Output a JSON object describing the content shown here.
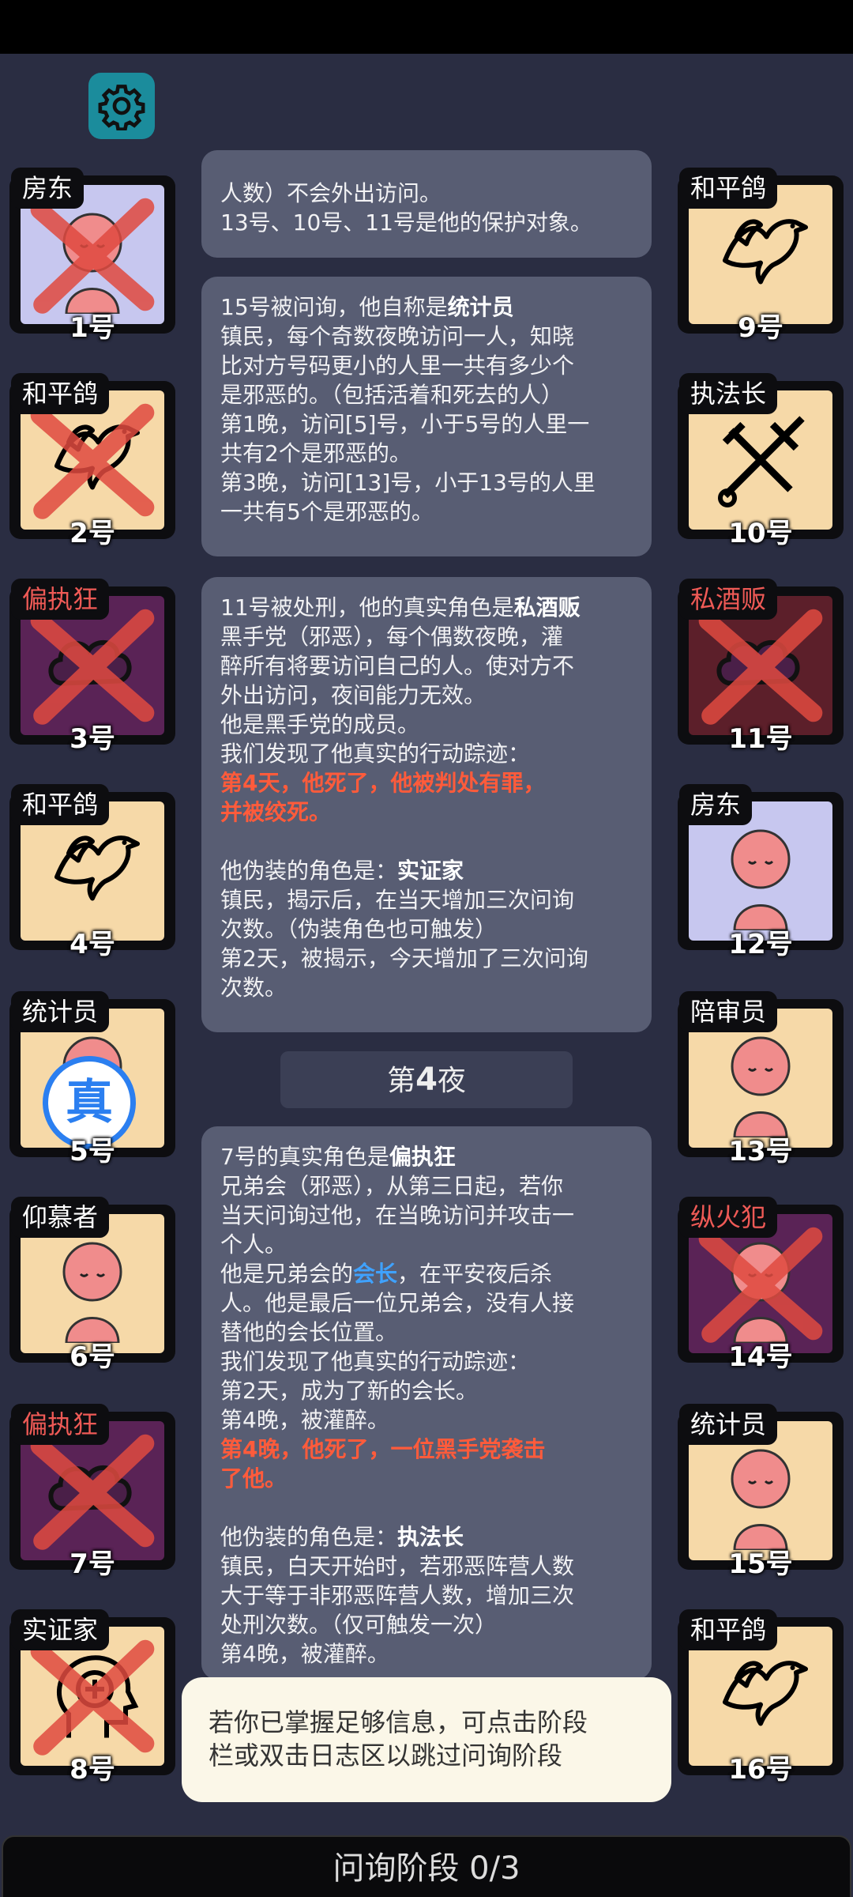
{
  "settings": {
    "icon": "gear-icon"
  },
  "left_cards": [
    {
      "role": "房东",
      "number": "1号",
      "bg": "#c7c7ef",
      "dead": true
    },
    {
      "role": "和平鸽",
      "number": "2号",
      "bg": "#f6d9a8",
      "dead": true
    },
    {
      "role": "偏执狂",
      "number": "3号",
      "bg": "#5a2356",
      "dead": true,
      "tag_color": "red"
    },
    {
      "role": "和平鸽",
      "number": "4号",
      "bg": "#f6d9a8",
      "dead": false
    },
    {
      "role": "统计员",
      "number": "5号",
      "bg": "#f6d9a8",
      "dead": false,
      "badge": "真"
    },
    {
      "role": "仰慕者",
      "number": "6号",
      "bg": "#f6d9a8",
      "dead": false
    },
    {
      "role": "偏执狂",
      "number": "7号",
      "bg": "#5a2356",
      "dead": true,
      "tag_color": "red"
    },
    {
      "role": "实证家",
      "number": "8号",
      "bg": "#f6d9a8",
      "dead": true
    }
  ],
  "right_cards": [
    {
      "role": "和平鸽",
      "number": "9号",
      "bg": "#f6d9a8",
      "dead": false
    },
    {
      "role": "执法长",
      "number": "10号",
      "bg": "#f6d9a8",
      "dead": false
    },
    {
      "role": "私酒贩",
      "number": "11号",
      "bg": "#5c1f2a",
      "dead": true,
      "tag_color": "red"
    },
    {
      "role": "房东",
      "number": "12号",
      "bg": "#c7c7ef",
      "dead": false
    },
    {
      "role": "陪审员",
      "number": "13号",
      "bg": "#f6d9a8",
      "dead": false
    },
    {
      "role": "纵火犯",
      "number": "14号",
      "bg": "#5a2356",
      "dead": true,
      "tag_color": "red"
    },
    {
      "role": "统计员",
      "number": "15号",
      "bg": "#f6d9a8",
      "dead": false
    },
    {
      "role": "和平鸽",
      "number": "16号",
      "bg": "#f6d9a8",
      "dead": false
    }
  ],
  "log": {
    "entry1": {
      "line1": "人数）不会外出访问。",
      "line2": "13号、10号、11号是他的保护对象。"
    },
    "entry2": {
      "intro": "15号被问询，他自称是",
      "role": "统计员",
      "lines": [
        "镇民，每个奇数夜晚访问一人，知晓",
        "比对方号码更小的人里一共有多少个",
        "是邪恶的。（包括活着和死去的人）",
        "第1晚，访问[5]号，小于5号的人里一",
        "共有2个是邪恶的。",
        "第3晚，访问[13]号，小于13号的人里",
        "一共有5个是邪恶的。"
      ]
    },
    "entry3": {
      "intro": "11号被处刑，他的真实角色是",
      "role": "私酒贩",
      "lines": [
        "黑手党（邪恶），每个偶数夜晚，灌",
        "醉所有将要访问自己的人。使对方不",
        "外出访问，夜间能力无效。",
        "他是黑手党的成员。",
        "我们发现了他真实的行动踪迹："
      ],
      "kill1": "第4天，他死了，他被判处有罪，",
      "kill2": "并被绞死。",
      "disguise_intro": "他伪装的角色是：",
      "disguise_role": "实证家",
      "lines2": [
        "镇民，揭示后，在当天增加三次问询",
        "次数。（伪装角色也可触发）",
        "第2天，被揭示，今天增加了三次问询",
        "次数。"
      ]
    },
    "night": {
      "prefix": "第",
      "num": "4",
      "suffix": "夜"
    },
    "entry4": {
      "intro": "7号的真实角色是",
      "role": "偏执狂",
      "lines": [
        "兄弟会（邪恶），从第三日起，若你",
        "当天问询过他，在当晚访问并攻击一",
        "个人。"
      ],
      "leader_pre": "他是兄弟会的",
      "leader_word": "会长",
      "leader_post": "，在平安夜后杀",
      "lines_b": [
        "人。他是最后一位兄弟会，没有人接",
        "替他的会长位置。",
        "我们发现了他真实的行动踪迹：",
        "第2天，成为了新的会长。",
        "第4晚，被灌醉。"
      ],
      "kill1": "第4晚，他死了，一位黑手党袭击",
      "kill2": "了他。",
      "disguise_intro": "他伪装的角色是：",
      "disguise_role": "执法长",
      "lines2": [
        "镇民，白天开始时，若邪恶阵营人数",
        "大于等于非邪恶阵营人数，增加三次",
        "处刑次数。（仅可触发一次）",
        "第4晚，被灌醉。"
      ]
    }
  },
  "tip": {
    "line1": "若你已掌握足够信息，可点击阶段",
    "line2": "栏或双击日志区以跳过问询阶段"
  },
  "phase_bar": {
    "label": "问询阶段 0/3"
  }
}
